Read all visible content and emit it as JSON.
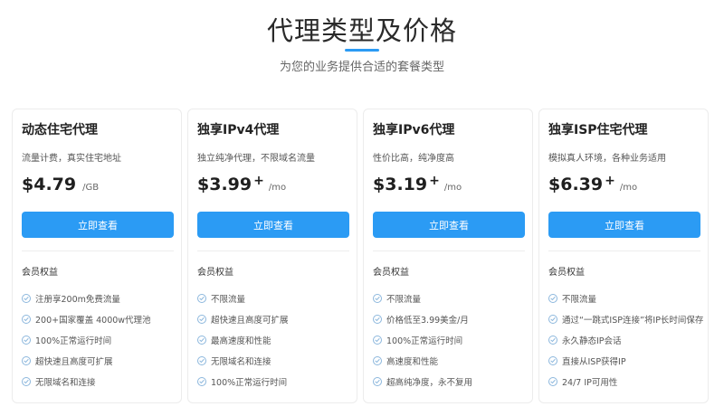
{
  "header": {
    "title": "代理类型及价格",
    "subtitle": "为您的业务提供合适的套餐类型"
  },
  "colors": {
    "accent": "#2b9bf4",
    "check": "#8cb7dd"
  },
  "plans": [
    {
      "name": "动态住宅代理",
      "desc": "流量计费，真实住宅地址",
      "price": "$4.79",
      "plus": "",
      "unit": "/GB",
      "button": "立即查看",
      "benefits_label": "会员权益",
      "benefits": [
        "注册享200m免费流量",
        "200+国家覆盖 4000w代理池",
        "100%正常运行时间",
        "超快速且高度可扩展",
        "无限域名和连接"
      ]
    },
    {
      "name": "独享IPv4代理",
      "desc": "独立纯净代理，不限域名流量",
      "price": "$3.99",
      "plus": "+",
      "unit": "/mo",
      "button": "立即查看",
      "benefits_label": "会员权益",
      "benefits": [
        "不限流量",
        "超快速且高度可扩展",
        "最高速度和性能",
        "无限域名和连接",
        "100%正常运行时间"
      ]
    },
    {
      "name": "独享IPv6代理",
      "desc": "性价比高，纯净度高",
      "price": "$3.19",
      "plus": "+",
      "unit": "/mo",
      "button": "立即查看",
      "benefits_label": "会员权益",
      "benefits": [
        "不限流量",
        "价格低至3.99美金/月",
        "100%正常运行时间",
        "高速度和性能",
        "超高纯净度，永不复用"
      ]
    },
    {
      "name": "独享ISP住宅代理",
      "desc": "模拟真人环境，各种业务适用",
      "price": "$6.39",
      "plus": "+",
      "unit": "/mo",
      "button": "立即查看",
      "benefits_label": "会员权益",
      "benefits": [
        "不限流量",
        "通过“一跳式ISP连接”将IP长时间保存",
        "永久静态IP会话",
        "直接从ISP获得IP",
        "24/7 IP可用性"
      ]
    }
  ]
}
